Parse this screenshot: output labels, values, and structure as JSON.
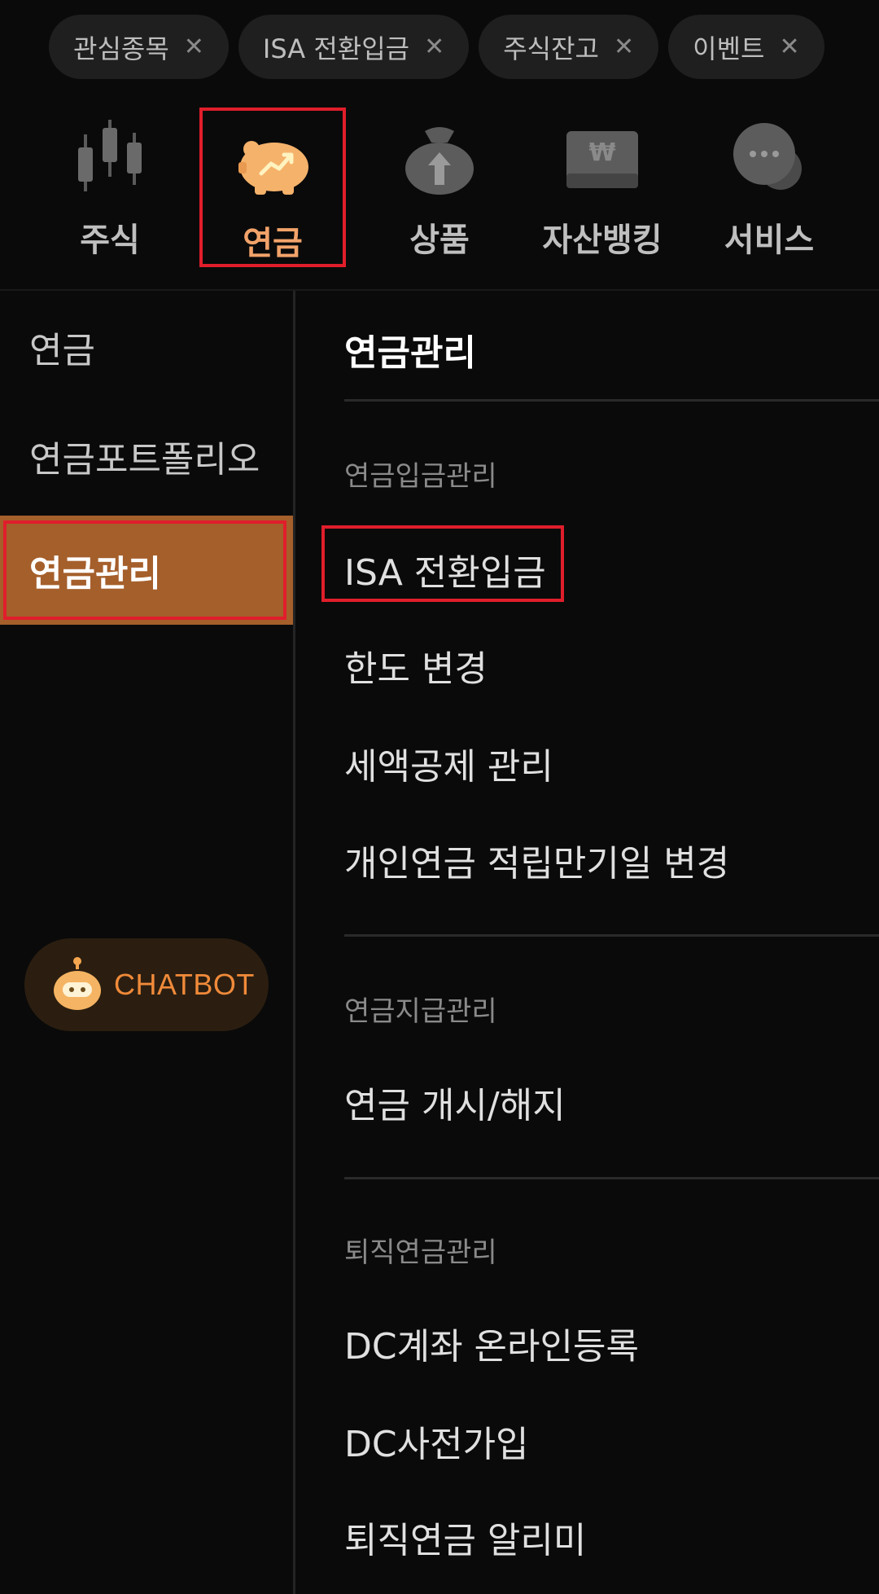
{
  "chips": [
    {
      "label": "관심종목",
      "close": "✕"
    },
    {
      "label": "ISA 전환입금",
      "close": "✕"
    },
    {
      "label": "주식잔고",
      "close": "✕"
    },
    {
      "label": "이벤트",
      "close": "✕"
    }
  ],
  "categories": [
    {
      "label": "주식",
      "icon": "candlestick-chart-icon"
    },
    {
      "label": "연금",
      "icon": "piggy-bank-icon",
      "active": true
    },
    {
      "label": "상품",
      "icon": "money-bag-icon"
    },
    {
      "label": "자산뱅킹",
      "icon": "won-card-icon"
    },
    {
      "label": "서비스",
      "icon": "chat-bubbles-icon"
    }
  ],
  "sidebar": {
    "items": [
      {
        "label": "연금"
      },
      {
        "label": "연금포트폴리오"
      },
      {
        "label": "연금관리",
        "active": true
      }
    ],
    "chatbot_label": "CHATBOT"
  },
  "content": {
    "title": "연금관리",
    "sections": [
      {
        "label": "연금입금관리",
        "items": [
          "ISA 전환입금",
          "한도 변경",
          "세액공제 관리",
          "개인연금 적립만기일 변경"
        ]
      },
      {
        "label": "연금지급관리",
        "items": [
          "연금 개시/해지"
        ]
      },
      {
        "label": "퇴직연금관리",
        "items": [
          "DC계좌 온라인등록",
          "DC사전가입",
          "퇴직연금 알리미"
        ]
      }
    ]
  },
  "colors": {
    "background": "#0a0a0a",
    "accent": "#f2a36a",
    "active_bg": "#a55f2b",
    "highlight": "#e01e2b"
  }
}
